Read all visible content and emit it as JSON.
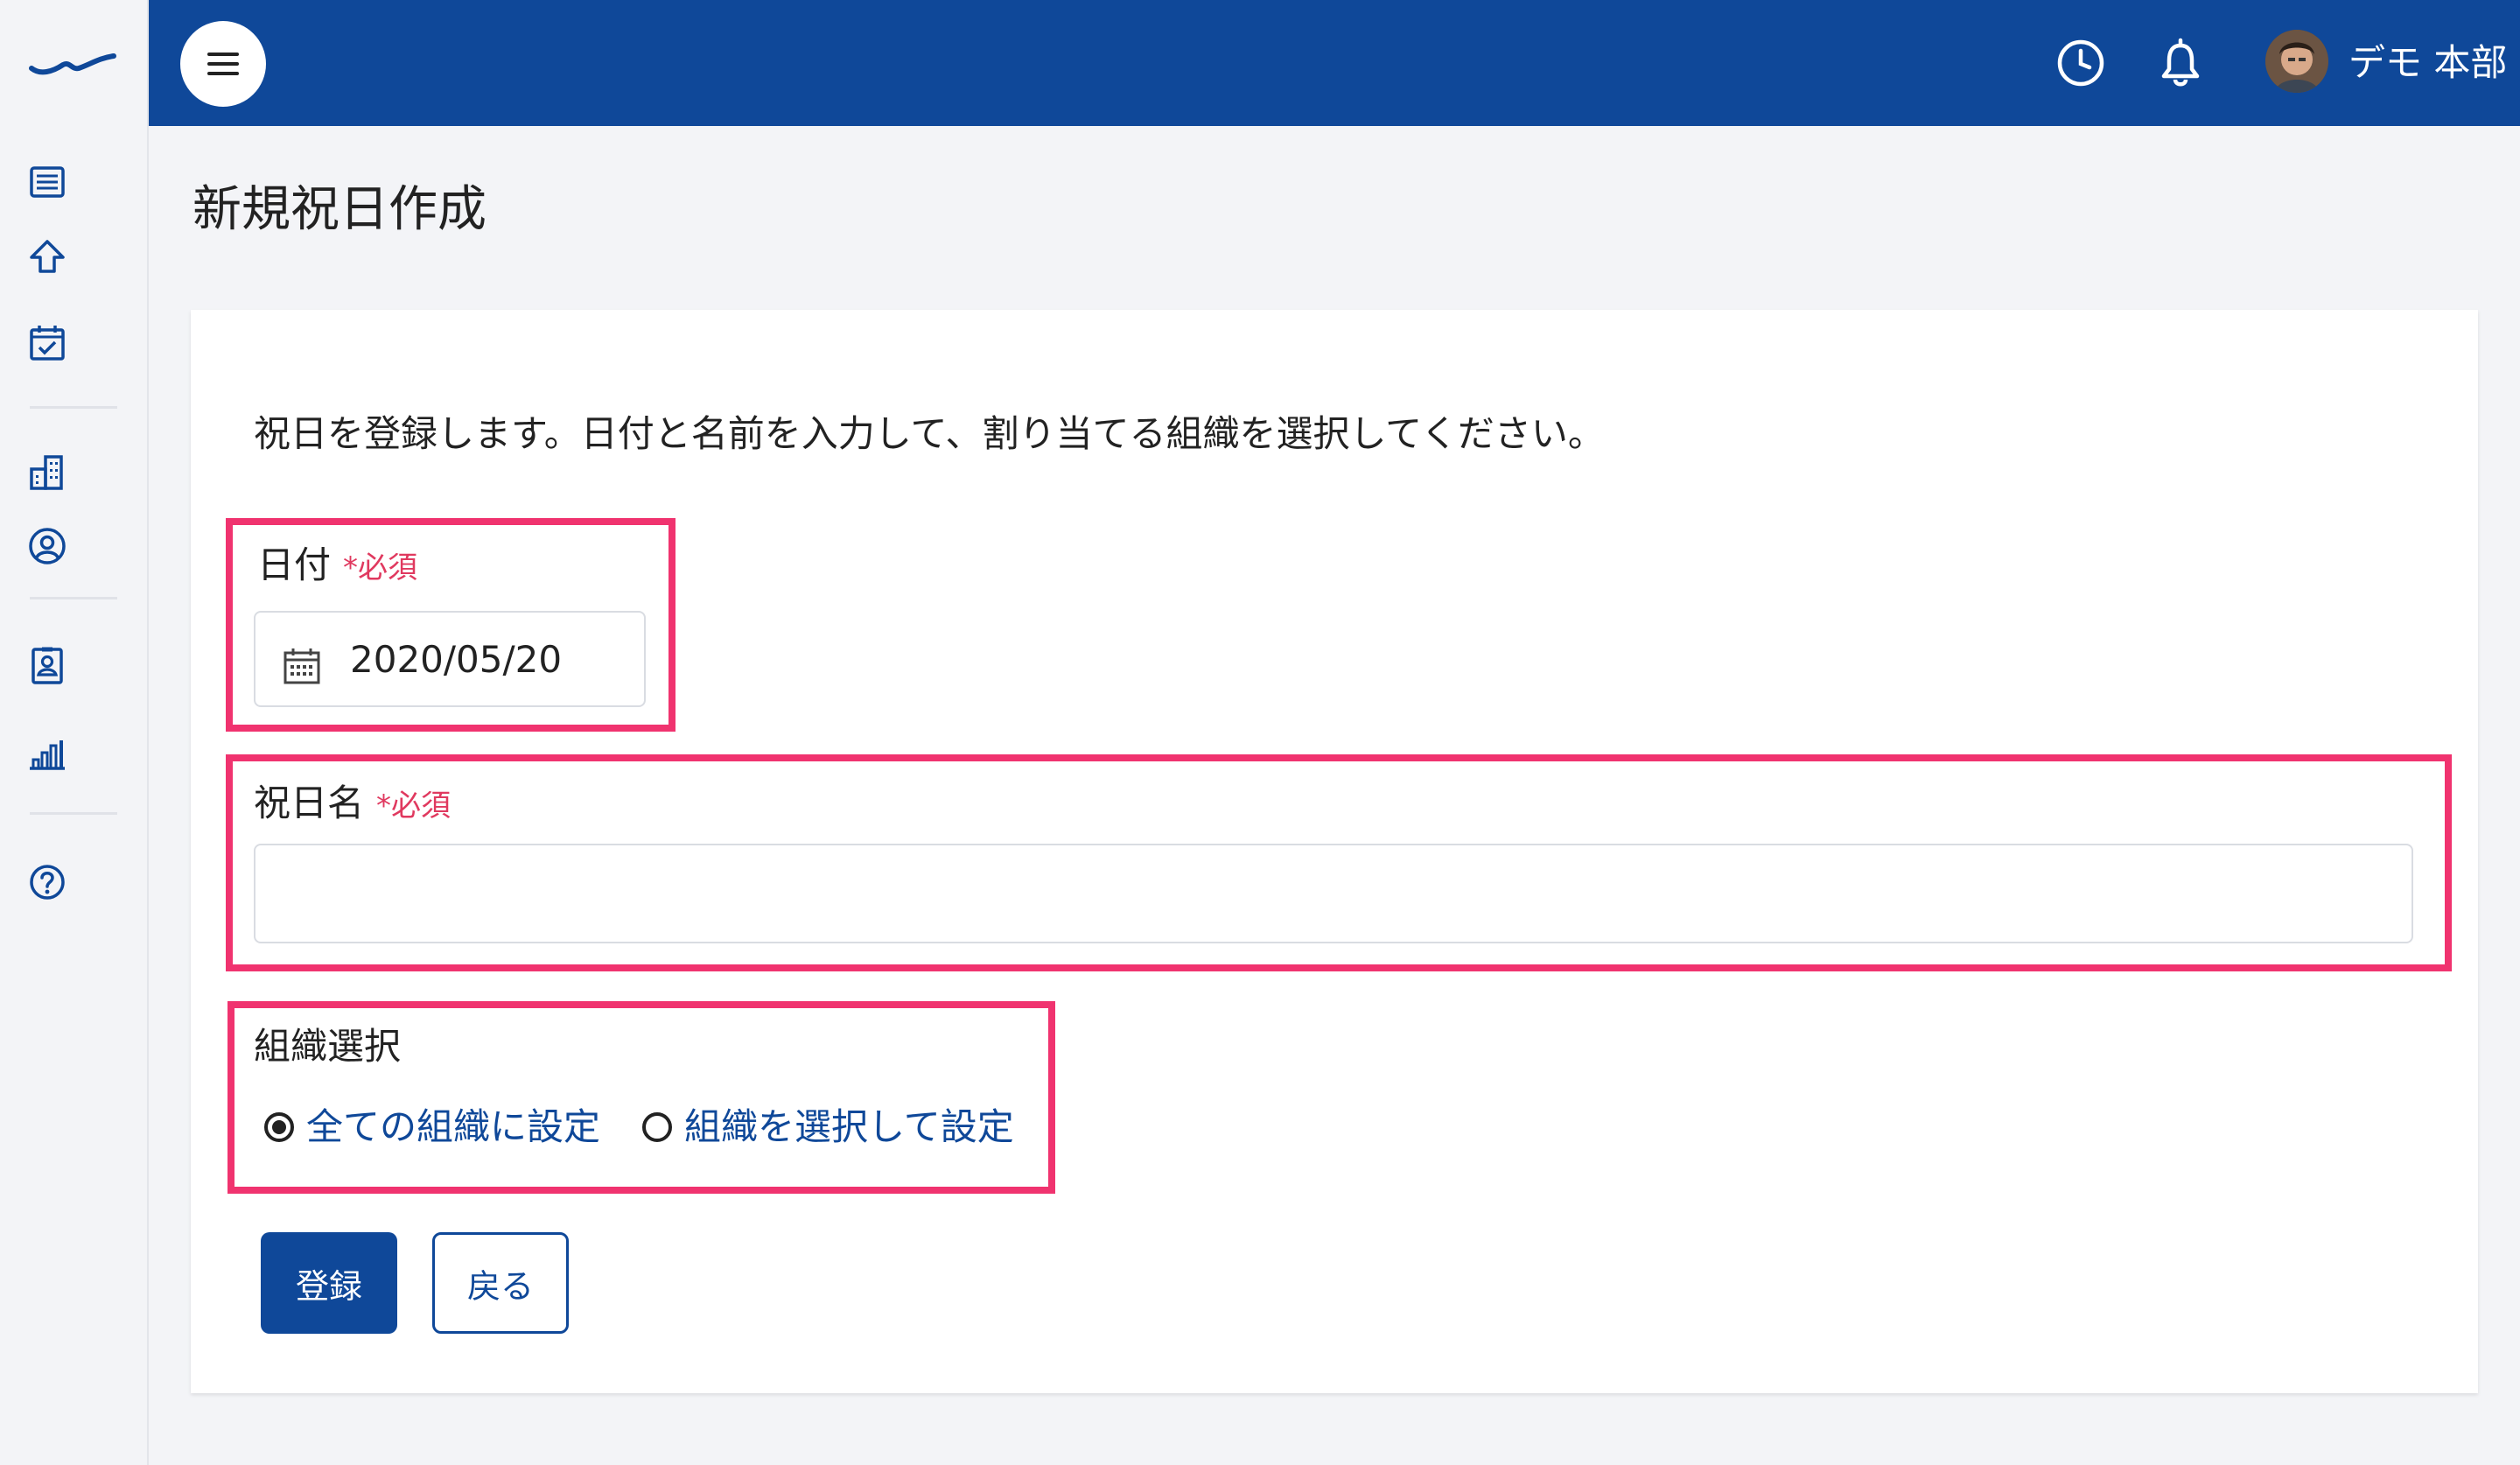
{
  "header": {
    "user_name": "デモ 本部"
  },
  "page": {
    "title": "新規祝日作成",
    "description": "祝日を登録します。日付と名前を入力して、割り当てる組織を選択してください。"
  },
  "form": {
    "date_field": {
      "label": "日付",
      "required_label": "*必須",
      "value": "2020/05/20"
    },
    "name_field": {
      "label": "祝日名",
      "required_label": "*必須",
      "value": ""
    },
    "org_select": {
      "label": "組織選択",
      "options": [
        {
          "label": "全ての組織に設定",
          "selected": true
        },
        {
          "label": "組織を選択して設定",
          "selected": false
        }
      ]
    },
    "buttons": {
      "submit": "登録",
      "back": "戻る"
    }
  },
  "colors": {
    "brand": "#0f4899",
    "highlight": "#f0336f",
    "required": "#e0395f"
  }
}
